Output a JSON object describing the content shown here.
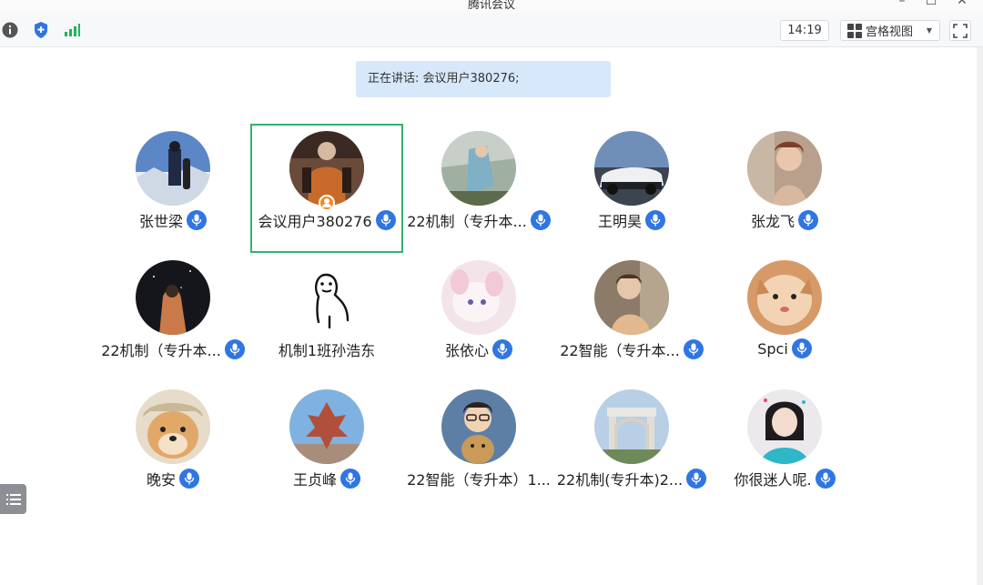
{
  "window": {
    "title": "腾讯会议"
  },
  "toolbar": {
    "clock": "14:19",
    "view_label": "宫格视图"
  },
  "speaking_banner": "正在讲话: 会议用户380276;",
  "participants": [
    {
      "name": "张世梁",
      "active": false,
      "host": false
    },
    {
      "name": "会议用户380276",
      "active": true,
      "host": true
    },
    {
      "name": "22机制（专升本...",
      "active": false,
      "host": false
    },
    {
      "name": "王明昊",
      "active": false,
      "host": false
    },
    {
      "name": "张龙飞",
      "active": false,
      "host": false
    },
    {
      "name": "22机制（专升本...",
      "active": false,
      "host": false
    },
    {
      "name": "机制1班孙浩东",
      "active": false,
      "host": false
    },
    {
      "name": "张依心",
      "active": false,
      "host": false
    },
    {
      "name": "22智能（专升本...",
      "active": false,
      "host": false
    },
    {
      "name": "Spci",
      "active": false,
      "host": false
    },
    {
      "name": "晚安",
      "active": false,
      "host": false
    },
    {
      "name": "王贞峰",
      "active": false,
      "host": false
    },
    {
      "name": "22智能（专升本）1...",
      "active": false,
      "host": false
    },
    {
      "name": "22机制(专升本)2...",
      "active": false,
      "host": false
    },
    {
      "name": "你很迷人呢.",
      "active": false,
      "host": false
    }
  ],
  "icons": {
    "info": "info-icon",
    "security": "shield-icon",
    "signal": "signal-icon",
    "view": "grid-view-icon",
    "fullscreen": "fullscreen-icon",
    "mic": "microphone-icon",
    "side": "list-icon"
  },
  "colors": {
    "accent_blue": "#2f76e3",
    "active_border": "#33b36e",
    "banner_bg": "#d7e8fb",
    "signal_green": "#21b45a",
    "host_orange": "#f08a24"
  }
}
